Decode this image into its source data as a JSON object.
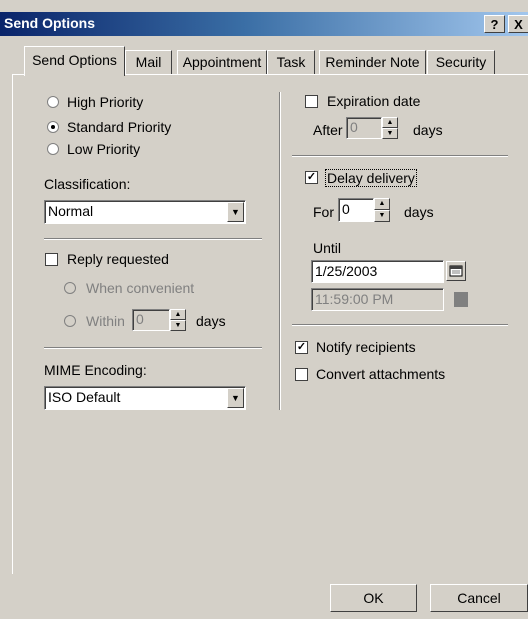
{
  "window": {
    "title": "Send Options",
    "help": "?",
    "close": "X"
  },
  "tabs": [
    {
      "label": "Send Options"
    },
    {
      "label": "Mail"
    },
    {
      "label": "Appointment"
    },
    {
      "label": "Task"
    },
    {
      "label": "Reminder Note"
    },
    {
      "label": "Security"
    }
  ],
  "priority": {
    "high": "High Priority",
    "standard": "Standard Priority",
    "low": "Low Priority",
    "selected": "standard"
  },
  "classification": {
    "label": "Classification:",
    "value": "Normal"
  },
  "reply": {
    "label": "Reply requested",
    "checked": false,
    "convenient": "When convenient",
    "within": "Within",
    "within_value": "0",
    "days": "days"
  },
  "mime": {
    "label": "MIME Encoding:",
    "value": "ISO Default"
  },
  "expiration": {
    "label": "Expiration date",
    "checked": false,
    "after": "After",
    "after_value": "0",
    "days": "days"
  },
  "delay": {
    "label": "Delay delivery",
    "checked": true,
    "for": "For",
    "for_value": "0",
    "days": "days",
    "until": "Until",
    "date": "1/25/2003",
    "time": "11:59:00 PM"
  },
  "notify": {
    "label": "Notify recipients",
    "checked": true
  },
  "convert": {
    "label": "Convert attachments",
    "checked": false
  },
  "buttons": {
    "ok": "OK",
    "cancel": "Cancel"
  }
}
